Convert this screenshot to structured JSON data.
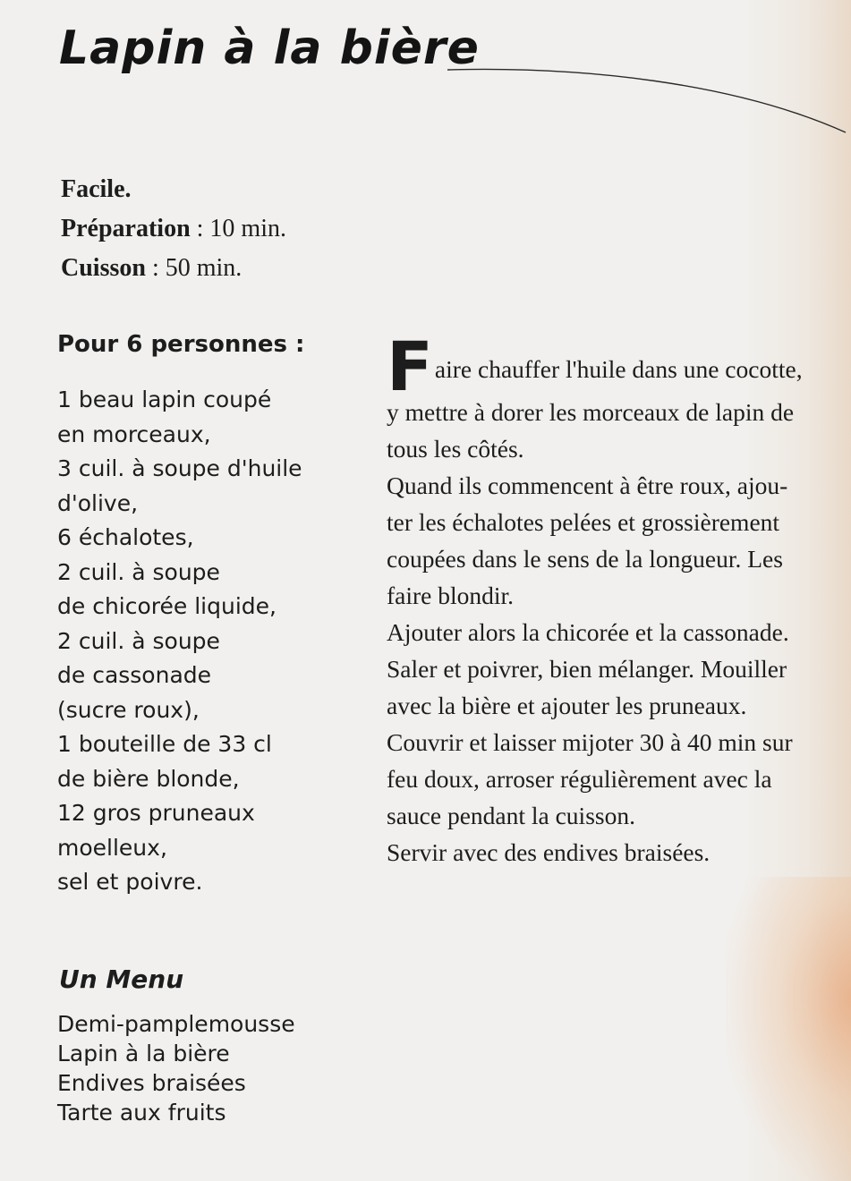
{
  "recipe": {
    "title": "Lapin à la bière",
    "meta": {
      "difficulty": "Facile.",
      "prep_label": "Préparation",
      "prep_value": "10 min.",
      "cook_label": "Cuisson",
      "cook_value": "50 min."
    },
    "ingredients_heading": "Pour 6 personnes :",
    "ingredients": [
      "1 beau lapin coupé",
      "en morceaux,",
      "3 cuil. à soupe d'huile",
      "d'olive,",
      "6 échalotes,",
      "2 cuil. à soupe",
      "de chicorée liquide,",
      "2 cuil. à soupe",
      "de cassonade",
      "(sucre roux),",
      "1 bouteille de 33 cl",
      "de bière blonde,",
      "12 gros pruneaux",
      "moelleux,",
      "sel et poivre."
    ],
    "method": {
      "dropcap": "F",
      "lines": [
        "aire chauffer l'huile dans une cocotte,",
        "y mettre à dorer les morceaux de lapin de",
        "tous les côtés.",
        "Quand ils commencent à être roux, ajou-",
        "ter les échalotes pelées et grossièrement",
        "coupées dans le sens de la longueur. Les",
        "faire blondir.",
        "Ajouter alors la chicorée et la cassonade.",
        "Saler et poivrer, bien mélanger. Mouiller",
        "avec la bière et ajouter les pruneaux.",
        "Couvrir et laisser mijoter 30 à 40 min sur",
        "feu doux, arroser régulièrement avec la",
        "sauce pendant la cuisson.",
        "Servir avec des endives braisées."
      ]
    },
    "menu": {
      "heading": "Un Menu",
      "items": [
        "Demi-pamplemousse",
        "Lapin à la bière",
        "Endives braisées",
        "Tarte aux fruits"
      ]
    }
  }
}
